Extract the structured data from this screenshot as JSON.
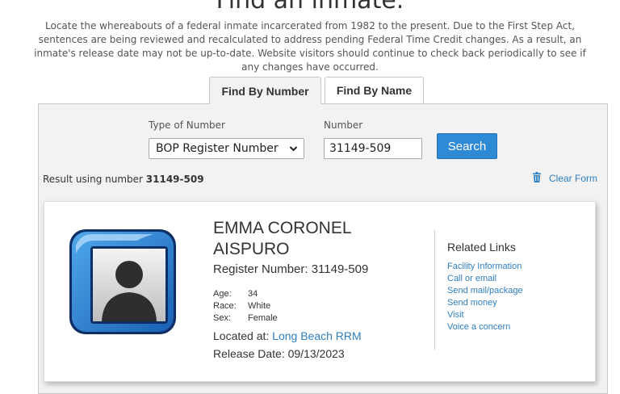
{
  "page_title": "Find an inmate.",
  "intro_text": "Locate the whereabouts of a federal inmate incarcerated from 1982 to the present. Due to the First Step Act, sentences are being reviewed and recalculated to address pending Federal Time Credit changes. As a result, an inmate's release date may not be up-to-date. Website visitors should continue to check back periodically to see if any changes have occurred.",
  "tabs": [
    {
      "label": "Find By Number"
    },
    {
      "label": "Find By Name"
    }
  ],
  "form": {
    "type_label": "Type of Number",
    "type_value": "BOP Register Number",
    "number_label": "Number",
    "number_value": "31149-509",
    "search_label": "Search"
  },
  "result": {
    "prefix": "Result using number ",
    "number": "31149-509",
    "clear_label": "Clear Form"
  },
  "inmate": {
    "name": "EMMA CORONEL AISPURO",
    "register_number": "Register Number: 31149-509",
    "details": [
      {
        "key": "Age:",
        "value": "34"
      },
      {
        "key": "Race:",
        "value": "White"
      },
      {
        "key": "Sex:",
        "value": "Female"
      }
    ],
    "located_prefix": "Located at: ",
    "location": "Long Beach RRM",
    "release_date": "Release Date: 09/13/2023"
  },
  "related": {
    "title": "Related Links",
    "links": [
      "Facility Information",
      "Call or email",
      "Send mail/package",
      "Send money",
      "Visit",
      "Voice a concern"
    ]
  },
  "colors": {
    "accent": "#2f8ad6",
    "link": "#2f7fc1",
    "panel_bg": "#f2f2f2"
  },
  "icons": {
    "clear": "trash-icon",
    "select": "chevron-down-icon",
    "avatar": "person-silhouette-icon"
  }
}
